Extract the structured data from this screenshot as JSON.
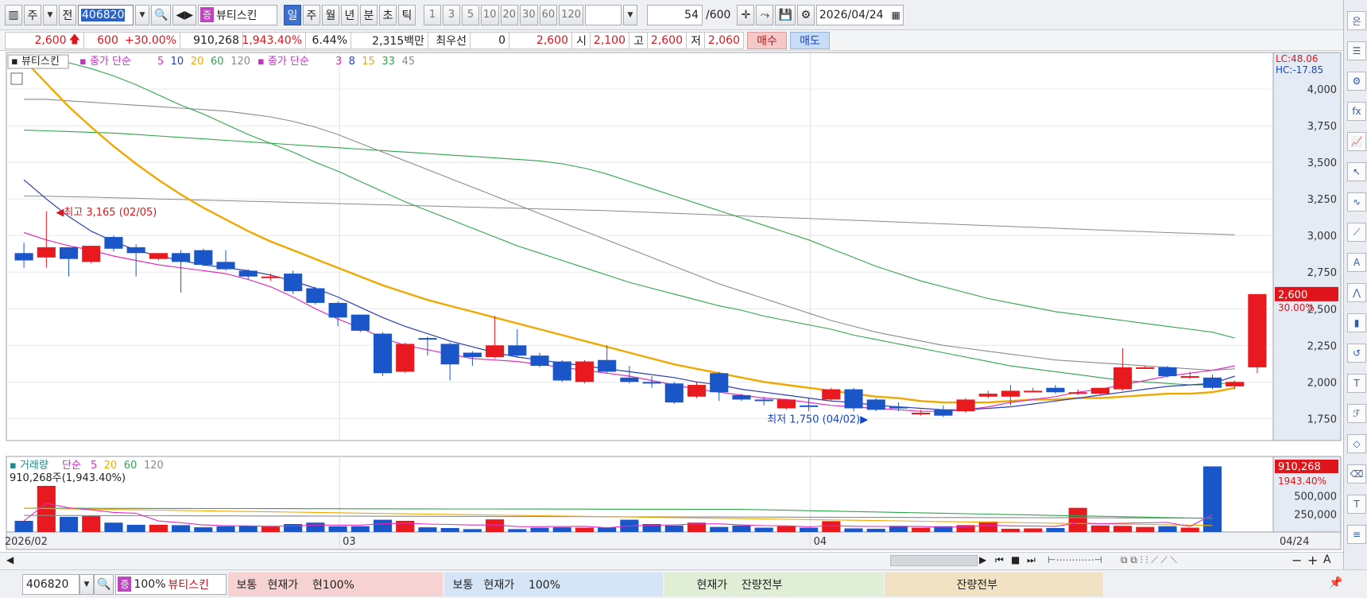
{
  "toolbar": {
    "period_label": "주",
    "prev_label": "전",
    "stock_code": "406820",
    "stock_badge": "증",
    "stock_name": "뷰티스킨",
    "periods": [
      "일",
      "주",
      "월",
      "년",
      "분",
      "초",
      "틱"
    ],
    "active_period": "일",
    "intervals": [
      "1",
      "3",
      "5",
      "10",
      "20",
      "30",
      "60",
      "120"
    ],
    "count_value": "54",
    "count_total": "/600",
    "date": "2026/04/24"
  },
  "quote": {
    "price": "2,600",
    "change": "600",
    "change_pct": "+30.00%",
    "volume": "910,268",
    "volume_ratio": "1,943.40%",
    "turnover": "6.44%",
    "amount": "2,315백만",
    "priority_label": "최우선",
    "priority_value": "0",
    "ask_price": "2,600",
    "open_label": "시",
    "open_value": "2,100",
    "high_label": "고",
    "high_value": "2,600",
    "low_label": "저",
    "low_value": "2,060",
    "buy_label": "매수",
    "sell_label": "매도"
  },
  "legend": {
    "stock": "뷰티스킨",
    "ma1_label": "종가 단순",
    "ma1_periods": [
      "5",
      "10",
      "20",
      "60",
      "120"
    ],
    "ma2_label": "종가 단순",
    "ma2_periods": [
      "3",
      "8",
      "15",
      "33",
      "45"
    ],
    "volume_label": "거래량",
    "vol_ma_label": "단순",
    "vol_ma_periods": [
      "5",
      "20",
      "60",
      "120"
    ],
    "volume_readout": "910,268주(1,943.40%)"
  },
  "annotations": {
    "high": "최고 3,165 (02/05)",
    "low": "최저 1,750 (04/02)",
    "lc": "LC:48.06",
    "hc": "HC:-17.85",
    "price_tag": "2,600",
    "price_pct": "30.00%",
    "vol_tag": "910,268",
    "vol_pct": "1943.40%"
  },
  "bottom": {
    "code": "406820",
    "badge": "증",
    "zoom": "100%",
    "name": "뷰티스킨",
    "panel1": "보통   현재가    현100%",
    "panel2": "보통   현재가    100%",
    "panel3": "현재가    잔량전부",
    "panel4": "잔량전부"
  },
  "colors": {
    "up": "#e8191f",
    "down": "#1a56c8",
    "ma5": "#e02fbf",
    "ma10": "#2a3fb0",
    "ma20": "#f0a800",
    "ma60": "#2da64a",
    "ma120": "#8a8a8a"
  },
  "chart_data": {
    "type": "candlestick",
    "x_ticks": [
      "2026/02",
      "03",
      "04",
      "04/24"
    ],
    "y_ticks": [
      1750,
      2000,
      2250,
      2500,
      2750,
      3000,
      3250,
      3500,
      3750,
      4000
    ],
    "ylim": [
      1600,
      4250
    ],
    "vol_ticks": [
      "250,000",
      "500,000"
    ],
    "vol_max": 960000,
    "candles": [
      [
        2880,
        2830,
        2950,
        2780
      ],
      [
        2850,
        2920,
        3165,
        2780
      ],
      [
        2920,
        2840,
        2920,
        2720
      ],
      [
        2820,
        2930,
        2930,
        2810
      ],
      [
        2990,
        2910,
        3000,
        2890
      ],
      [
        2920,
        2880,
        2940,
        2720
      ],
      [
        2840,
        2880,
        2880,
        2830
      ],
      [
        2880,
        2820,
        2900,
        2610
      ],
      [
        2900,
        2800,
        2910,
        2790
      ],
      [
        2820,
        2770,
        2900,
        2760
      ],
      [
        2760,
        2720,
        2770,
        2700
      ],
      [
        2710,
        2720,
        2740,
        2690
      ],
      [
        2740,
        2620,
        2760,
        2600
      ],
      [
        2640,
        2540,
        2650,
        2530
      ],
      [
        2540,
        2440,
        2550,
        2380
      ],
      [
        2460,
        2350,
        2460,
        2340
      ],
      [
        2330,
        2060,
        2340,
        2040
      ],
      [
        2070,
        2260,
        2270,
        2060
      ],
      [
        2300,
        2290,
        2310,
        2180
      ],
      [
        2260,
        2120,
        2270,
        2010
      ],
      [
        2200,
        2170,
        2210,
        2110
      ],
      [
        2170,
        2250,
        2450,
        2160
      ],
      [
        2250,
        2180,
        2360,
        2170
      ],
      [
        2180,
        2110,
        2200,
        2100
      ],
      [
        2140,
        2010,
        2150,
        2000
      ],
      [
        2000,
        2140,
        2150,
        1990
      ],
      [
        2150,
        2070,
        2250,
        2060
      ],
      [
        2030,
        2000,
        2110,
        1990
      ],
      [
        2000,
        1990,
        2040,
        1960
      ],
      [
        1990,
        1860,
        2000,
        1850
      ],
      [
        1900,
        1980,
        2000,
        1890
      ],
      [
        2060,
        1930,
        2070,
        1870
      ],
      [
        1910,
        1880,
        1920,
        1870
      ],
      [
        1880,
        1870,
        1900,
        1840
      ],
      [
        1820,
        1880,
        1880,
        1810
      ],
      [
        1840,
        1830,
        1890,
        1800
      ],
      [
        1880,
        1950,
        1960,
        1870
      ],
      [
        1950,
        1820,
        1960,
        1800
      ],
      [
        1880,
        1810,
        1890,
        1800
      ],
      [
        1830,
        1820,
        1860,
        1800
      ],
      [
        1780,
        1790,
        1810,
        1770
      ],
      [
        1810,
        1770,
        1840,
        1760
      ],
      [
        1800,
        1880,
        1890,
        1790
      ],
      [
        1900,
        1920,
        1940,
        1890
      ],
      [
        1900,
        1940,
        1980,
        1840
      ],
      [
        1940,
        1940,
        1960,
        1930
      ],
      [
        1960,
        1930,
        1980,
        1920
      ],
      [
        1920,
        1930,
        1950,
        1910
      ],
      [
        1920,
        1960,
        1960,
        1910
      ],
      [
        1950,
        2100,
        2230,
        1940
      ],
      [
        2100,
        2100,
        2110,
        2090
      ],
      [
        2100,
        2040,
        2110,
        2030
      ],
      [
        2040,
        2040,
        2070,
        2020
      ],
      [
        2030,
        1960,
        2050,
        1950
      ],
      [
        1970,
        2000,
        2010,
        1950
      ],
      [
        2100,
        2600,
        2600,
        2060
      ]
    ],
    "volumes": [
      155000,
      640000,
      210000,
      220000,
      130000,
      100000,
      100000,
      95000,
      65000,
      80000,
      85000,
      75000,
      110000,
      130000,
      80000,
      80000,
      170000,
      155000,
      65000,
      55000,
      40000,
      175000,
      40000,
      60000,
      65000,
      60000,
      65000,
      170000,
      110000,
      90000,
      130000,
      70000,
      90000,
      60000,
      80000,
      60000,
      150000,
      50000,
      45000,
      85000,
      60000,
      80000,
      95000,
      145000,
      45000,
      50000,
      55000,
      335000,
      90000,
      85000,
      70000,
      80000,
      60000,
      910268
    ],
    "ma5": [
      3020,
      2970,
      2930,
      2900,
      2860,
      2830,
      2800,
      2780,
      2760,
      2740,
      2700,
      2650,
      2580,
      2500,
      2430,
      2370,
      2300,
      2250,
      2220,
      2190,
      2160,
      2150,
      2140,
      2120,
      2100,
      2080,
      2060,
      2040,
      2010,
      1980,
      1950,
      1930,
      1910,
      1890,
      1880,
      1860,
      1840,
      1830,
      1820,
      1810,
      1800,
      1800,
      1810,
      1830,
      1860,
      1880,
      1900,
      1930,
      1950,
      1980,
      2010,
      2040,
      2060,
      2080,
      2110
    ],
    "ma10": [
      3380,
      3250,
      3130,
      3030,
      2960,
      2900,
      2860,
      2830,
      2800,
      2780,
      2760,
      2730,
      2690,
      2640,
      2580,
      2510,
      2440,
      2380,
      2330,
      2280,
      2240,
      2200,
      2170,
      2150,
      2130,
      2110,
      2090,
      2070,
      2050,
      2030,
      2000,
      1980,
      1950,
      1930,
      1910,
      1890,
      1870,
      1860,
      1840,
      1830,
      1820,
      1810,
      1810,
      1820,
      1830,
      1850,
      1870,
      1890,
      1910,
      1930,
      1950,
      1970,
      1980,
      1990,
      2040
    ],
    "ma20": [
      4200,
      4040,
      3880,
      3740,
      3610,
      3490,
      3380,
      3280,
      3190,
      3110,
      3030,
      2960,
      2900,
      2840,
      2780,
      2720,
      2660,
      2610,
      2560,
      2520,
      2480,
      2440,
      2400,
      2360,
      2320,
      2280,
      2240,
      2200,
      2160,
      2120,
      2090,
      2060,
      2030,
      2000,
      1980,
      1960,
      1940,
      1920,
      1900,
      1890,
      1870,
      1860,
      1860,
      1860,
      1870,
      1880,
      1880,
      1890,
      1890,
      1900,
      1910,
      1920,
      1920,
      1930,
      1960
    ],
    "ma60": [
      4230,
      4210,
      4180,
      4140,
      4090,
      4030,
      3960,
      3890,
      3830,
      3760,
      3690,
      3630,
      3570,
      3500,
      3440,
      3370,
      3300,
      3230,
      3170,
      3110,
      3050,
      2990,
      2930,
      2880,
      2830,
      2780,
      2730,
      2680,
      2640,
      2600,
      2560,
      2520,
      2490,
      2450,
      2420,
      2390,
      2360,
      2320,
      2290,
      2260,
      2230,
      2200,
      2170,
      2140,
      2110,
      2090,
      2070,
      2050,
      2030,
      2010,
      2000,
      1990,
      1980,
      1980,
      2000
    ],
    "ma120": [
      3930,
      3930,
      3920,
      3910,
      3900,
      3890,
      3880,
      3870,
      3860,
      3850,
      3830,
      3810,
      3780,
      3740,
      3690,
      3630,
      3570,
      3510,
      3450,
      3390,
      3330,
      3270,
      3210,
      3150,
      3090,
      3030,
      2970,
      2910,
      2850,
      2790,
      2730,
      2670,
      2620,
      2570,
      2520,
      2470,
      2420,
      2380,
      2340,
      2310,
      2280,
      2250,
      2230,
      2210,
      2190,
      2170,
      2150,
      2140,
      2130,
      2120,
      2110,
      2100,
      2090,
      2080,
      2090
    ],
    "ma60b": [
      3720,
      3715,
      3710,
      3705,
      3700,
      3690,
      3680,
      3670,
      3660,
      3650,
      3640,
      3630,
      3620,
      3610,
      3600,
      3590,
      3580,
      3570,
      3560,
      3550,
      3540,
      3530,
      3520,
      3510,
      3490,
      3460,
      3420,
      3370,
      3320,
      3270,
      3220,
      3170,
      3120,
      3070,
      3020,
      2970,
      2910,
      2850,
      2790,
      2740,
      2690,
      2650,
      2610,
      2570,
      2540,
      2510,
      2480,
      2460,
      2440,
      2420,
      2400,
      2380,
      2360,
      2340,
      2300
    ],
    "ma120b": [
      3270,
      3268,
      3265,
      3262,
      3258,
      3254,
      3250,
      3246,
      3242,
      3238,
      3234,
      3230,
      3226,
      3222,
      3218,
      3214,
      3210,
      3206,
      3202,
      3198,
      3194,
      3190,
      3186,
      3182,
      3178,
      3174,
      3170,
      3164,
      3158,
      3152,
      3146,
      3140,
      3134,
      3128,
      3122,
      3116,
      3110,
      3104,
      3098,
      3092,
      3086,
      3080,
      3074,
      3068,
      3062,
      3056,
      3050,
      3044,
      3038,
      3032,
      3026,
      3020,
      3015,
      3010,
      3005
    ]
  }
}
